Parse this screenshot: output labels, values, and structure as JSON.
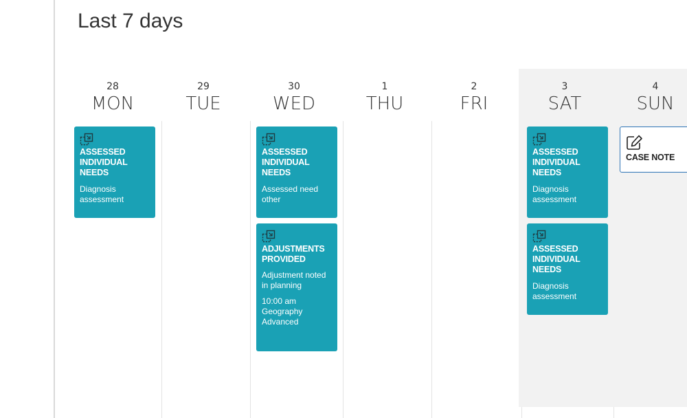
{
  "page": {
    "title": "Last 7 days"
  },
  "days": [
    {
      "num": "28",
      "name": "MON"
    },
    {
      "num": "29",
      "name": "TUE"
    },
    {
      "num": "30",
      "name": "WED"
    },
    {
      "num": "1",
      "name": "THU"
    },
    {
      "num": "2",
      "name": "FRI"
    },
    {
      "num": "3",
      "name": "SAT"
    },
    {
      "num": "4",
      "name": "SUN"
    }
  ],
  "events": {
    "mon": [
      {
        "title": "ASSESSED INDIVIDUAL NEEDS",
        "desc": "Diagnosis assessment",
        "icon": "external-link-icon"
      }
    ],
    "wed": [
      {
        "title": "ASSESSED INDIVIDUAL NEEDS",
        "desc": "Assessed need other",
        "icon": "external-link-icon"
      },
      {
        "title": "ADJUSTMENTS PROVIDED",
        "desc": "Adjustment noted in planning",
        "extra": "10:00 am Geography Advanced",
        "icon": "external-link-icon"
      }
    ],
    "sat": [
      {
        "title": "ASSESSED INDIVIDUAL NEEDS",
        "desc": "Diagnosis assessment",
        "icon": "external-link-icon"
      },
      {
        "title": "ASSESSED INDIVIDUAL NEEDS",
        "desc": "Diagnosis assessment",
        "icon": "external-link-icon"
      }
    ],
    "sun": [
      {
        "title": "CASE NOTE",
        "icon": "edit-note-icon"
      }
    ]
  },
  "colors": {
    "card": "#1aa1b5",
    "case_note_border": "#2e74b5",
    "weekend_bg": "#f2f2f2"
  }
}
